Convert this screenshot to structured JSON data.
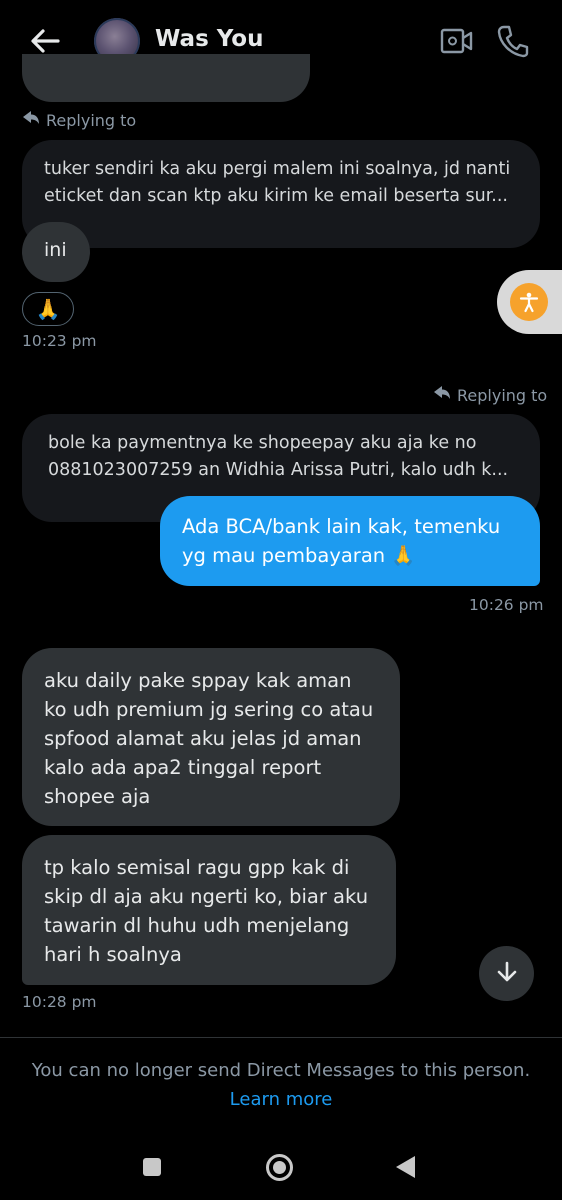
{
  "header": {
    "title": "Was You"
  },
  "messages": {
    "reply1_label": "Replying to",
    "reply1_quote": "tuker sendiri ka aku pergi malem ini soalnya, jd nanti eticket dan scan ktp aku kirim ke email beserta sur...",
    "msg_ini": "ini",
    "reaction": "🙏",
    "time1": "10:23 pm",
    "reply2_label": "Replying to",
    "reply2_quote": "bole ka paymentnya ke shopeepay aku aja ke no 0881023007259 an Widhia Arissa Putri, kalo udh k...",
    "out_msg": "Ada BCA/bank lain kak, temenku yg mau pembayaran 🙏",
    "time2": "10:26 pm",
    "in_msg1": "aku daily pake sppay kak aman ko udh premium jg sering co atau spfood alamat aku jelas jd aman kalo ada apa2 tinggal report shopee aja",
    "in_msg2": "tp kalo semisal ragu gpp kak di skip dl aja aku ngerti ko, biar aku tawarin dl huhu udh menjelang hari h soalnya",
    "time3": "10:28 pm"
  },
  "footer": {
    "notice": "You can no longer send Direct Messages to this person.",
    "learn_more": "Learn more"
  },
  "icons": {
    "back": "arrow-left-icon",
    "video": "video-camera-icon",
    "call": "phone-icon",
    "reply": "reply-arrow-icon",
    "accessibility": "accessibility-icon",
    "scroll_down": "arrow-down-icon"
  },
  "colors": {
    "accent": "#1d9bf0",
    "incoming_bubble": "#2f3336",
    "background": "#000000"
  }
}
